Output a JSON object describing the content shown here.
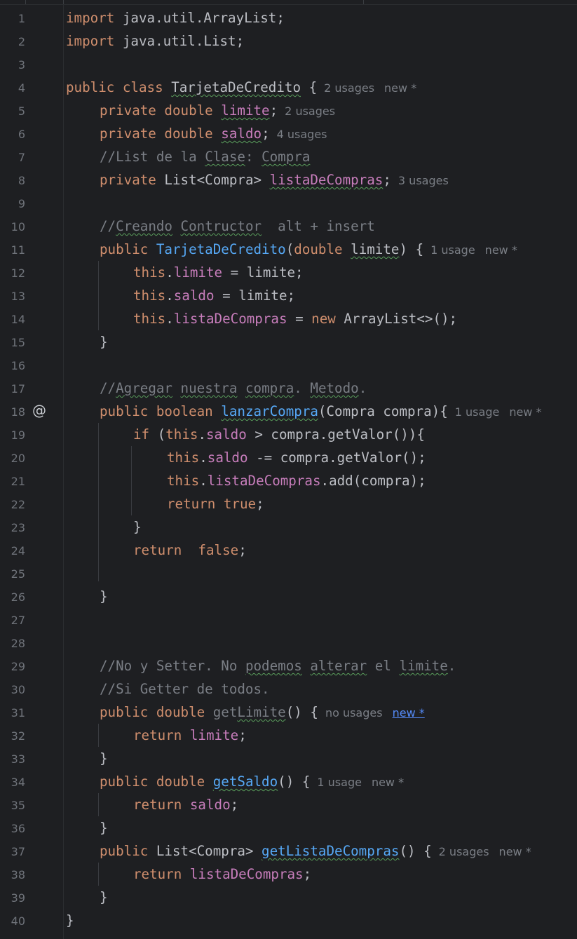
{
  "editor": {
    "lines": [
      {
        "n": "1"
      },
      {
        "n": "2"
      },
      {
        "n": "3"
      },
      {
        "n": "4"
      },
      {
        "n": "5"
      },
      {
        "n": "6"
      },
      {
        "n": "7"
      },
      {
        "n": "8"
      },
      {
        "n": "9"
      },
      {
        "n": "10"
      },
      {
        "n": "11"
      },
      {
        "n": "12"
      },
      {
        "n": "13"
      },
      {
        "n": "14"
      },
      {
        "n": "15"
      },
      {
        "n": "16"
      },
      {
        "n": "17"
      },
      {
        "n": "18"
      },
      {
        "n": "19"
      },
      {
        "n": "20"
      },
      {
        "n": "21"
      },
      {
        "n": "22"
      },
      {
        "n": "23"
      },
      {
        "n": "24"
      },
      {
        "n": "25"
      },
      {
        "n": "26"
      },
      {
        "n": "27"
      },
      {
        "n": "28"
      },
      {
        "n": "29"
      },
      {
        "n": "30"
      },
      {
        "n": "31"
      },
      {
        "n": "32"
      },
      {
        "n": "33"
      },
      {
        "n": "34"
      },
      {
        "n": "35"
      },
      {
        "n": "36"
      },
      {
        "n": "37"
      },
      {
        "n": "38"
      },
      {
        "n": "39"
      },
      {
        "n": "40"
      }
    ],
    "gutter_icon": "@",
    "code": {
      "l1": [
        "import",
        " java.util.ArrayList;"
      ],
      "l2": [
        "import",
        " java.util.List;"
      ],
      "l4": [
        "public class",
        " ",
        "TarjetaDeCredito",
        " {"
      ],
      "l5": [
        "private double",
        " ",
        "limite",
        ";"
      ],
      "l6": [
        "private double",
        " ",
        "saldo",
        ";"
      ],
      "l7": [
        "//List de la ",
        "Clase",
        ": ",
        "Compra"
      ],
      "l8": [
        "private",
        " List<Compra> ",
        "listaDeCompras",
        ";"
      ],
      "l10": [
        "//",
        "Creando",
        " ",
        "Contructor",
        "  alt + insert"
      ],
      "l11": [
        "public",
        " ",
        "TarjetaDeCredito",
        "(",
        "double",
        " ",
        "limite",
        ") {"
      ],
      "l12": [
        "this",
        ".",
        "limite",
        " = limite;"
      ],
      "l13": [
        "this",
        ".",
        "saldo",
        " = limite;"
      ],
      "l14": [
        "this",
        ".",
        "listaDeCompras",
        " = ",
        "new",
        " ArrayList<>();"
      ],
      "l15": [
        "}"
      ],
      "l17": [
        "//",
        "Agregar",
        " ",
        "nuestra",
        " ",
        "compra",
        ". ",
        "Metodo",
        "."
      ],
      "l18": [
        "public boolean",
        " ",
        "lanzarCompra",
        "(Compra compra){"
      ],
      "l19": [
        "if",
        " (",
        "this",
        ".",
        "saldo",
        " > compra.getValor()){"
      ],
      "l20": [
        "this",
        ".",
        "saldo",
        " -= compra.getValor();"
      ],
      "l21": [
        "this",
        ".",
        "listaDeCompras",
        ".add(compra);"
      ],
      "l22": [
        "return true",
        ";"
      ],
      "l23": [
        "}"
      ],
      "l24": [
        "return  false",
        ";"
      ],
      "l26": [
        "}"
      ],
      "l29": [
        "//No y Setter. No ",
        "podemos",
        " ",
        "alterar",
        " el ",
        "limite",
        "."
      ],
      "l30": [
        "//Si Getter de todos."
      ],
      "l31": [
        "public double",
        " get",
        "Limite",
        "() {"
      ],
      "l32": [
        "return",
        " ",
        "limite",
        ";"
      ],
      "l33": [
        "}"
      ],
      "l34": [
        "public double",
        " ",
        "getSaldo",
        "() {"
      ],
      "l35": [
        "return",
        " ",
        "saldo",
        ";"
      ],
      "l36": [
        "}"
      ],
      "l37": [
        "public",
        " List<Compra> ",
        "getListaDeCompras",
        "() {"
      ],
      "l38": [
        "return",
        " ",
        "listaDeCompras",
        ";"
      ],
      "l39": [
        "}"
      ],
      "l40": [
        "}"
      ]
    },
    "hints": {
      "l4": {
        "usages": "2 usages",
        "new": "new *"
      },
      "l5": {
        "usages": "2 usages"
      },
      "l6": {
        "usages": "4 usages"
      },
      "l8": {
        "usages": "3 usages"
      },
      "l11": {
        "usages": "1 usage",
        "new": "new *"
      },
      "l18": {
        "usages": "1 usage",
        "new": "new *"
      },
      "l31": {
        "usages": "no usages",
        "new": "new *"
      },
      "l34": {
        "usages": "1 usage",
        "new": "new *"
      },
      "l37": {
        "usages": "2 usages",
        "new": "new *"
      }
    }
  },
  "colors": {
    "background": "#1e1f22",
    "keyword": "#cf8e6d",
    "field": "#c77dbb",
    "function": "#56a8f5",
    "comment": "#7a7e85",
    "text": "#bcbec4",
    "link": "#548af7"
  }
}
